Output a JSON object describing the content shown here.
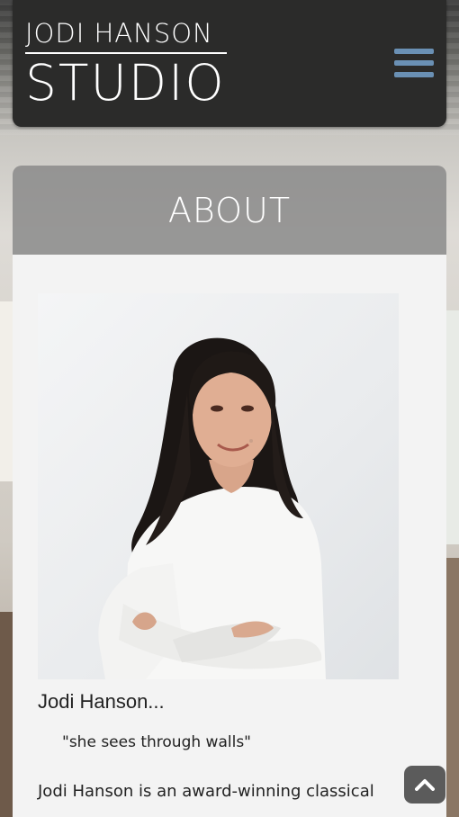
{
  "header": {
    "logo_line1": "JODI HANSON",
    "logo_line2": "STUDIO",
    "menu_icon": "hamburger-icon",
    "menu_color": "#6a90b4"
  },
  "section": {
    "title": "ABOUT"
  },
  "about": {
    "name": "Jodi Hanson...",
    "quote": "\"she sees through walls\"",
    "intro": "Jodi Hanson is an award-winning classical"
  },
  "controls": {
    "scroll_top_icon": "chevron-up-icon"
  }
}
